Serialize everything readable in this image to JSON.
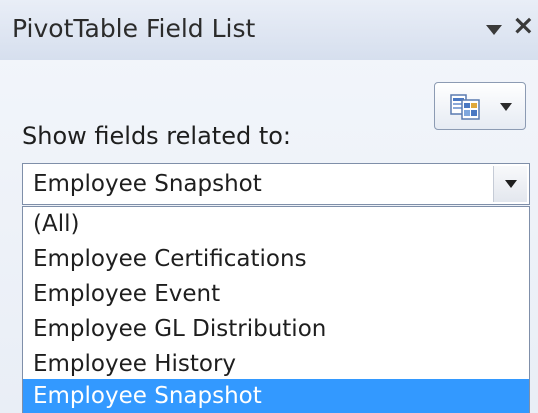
{
  "window": {
    "title": "PivotTable Field List",
    "dropdown_icon": "triangle-down-icon",
    "close_glyph": "×"
  },
  "toolbar": {
    "layout_button_icon": "field-list-layout-icon",
    "layout_button_caret": "chevron-down-icon"
  },
  "filter": {
    "label": "Show fields related to:",
    "selected_value": "Employee Snapshot",
    "options": [
      "(All)",
      "Employee Certifications",
      "Employee Event",
      "Employee GL Distribution",
      "Employee History",
      "Employee Snapshot"
    ],
    "highlighted_option": "Employee Snapshot"
  },
  "colors": {
    "highlight": "#3399ff",
    "border": "#7f8fa9"
  }
}
